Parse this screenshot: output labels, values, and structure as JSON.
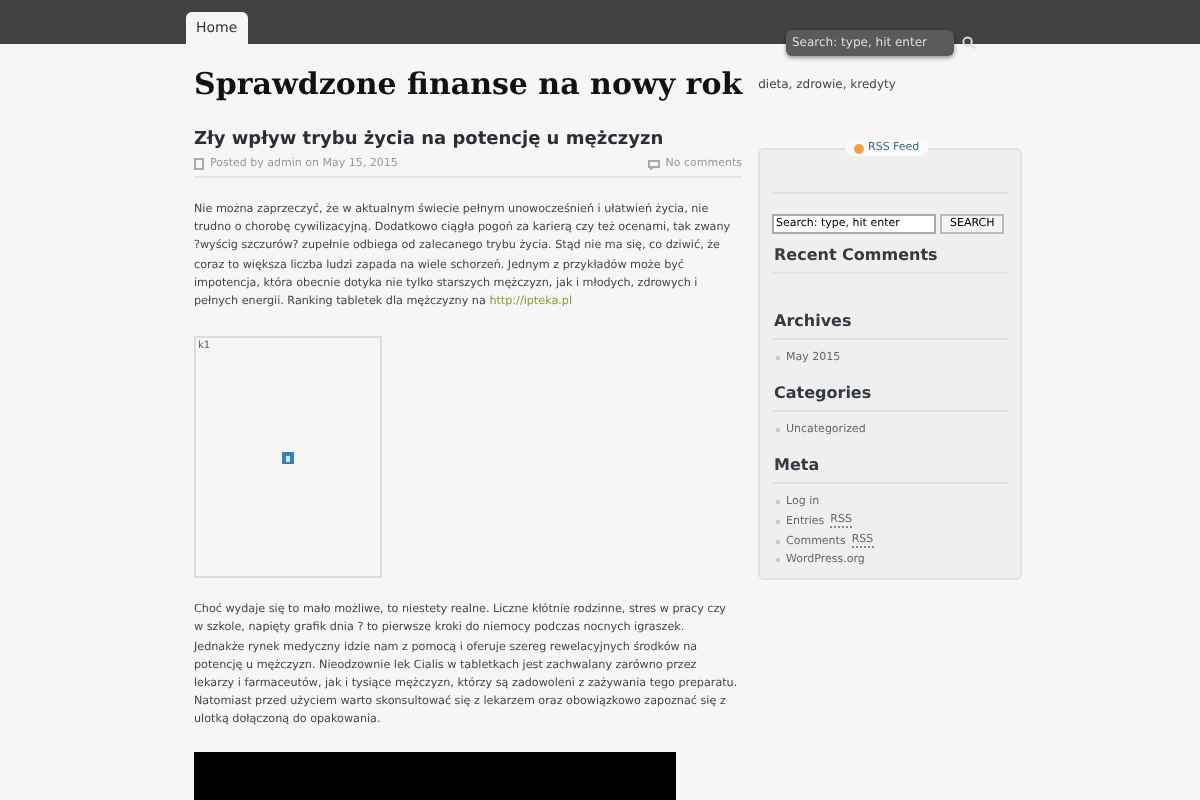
{
  "nav": {
    "tabs": [
      {
        "label": "Home",
        "selected": true
      }
    ],
    "search": {
      "placeholder": "Search: type, hit enter"
    }
  },
  "site": {
    "title": "Sprawdzone finanse na nowy rok",
    "tagline": "dieta, zdrowie, kredyty"
  },
  "post": {
    "title": "Zły wpływ trybu życia na potencję u mężczyzn",
    "meta": "Posted by admin on May 15, 2015",
    "comments": "No comments",
    "paragraph_1": {
      "text": "Nie można zaprzeczyć, że w aktualnym świecie pełnym unowocześnień i ułatwień życia, nie trudno o chorobę cywilizacyjną. Dodatkowo ciągła pogoń za karierą czy też ocenami, tak zwany ?wyścig szczurów? zupełnie odbiega od zalecanego trybu życia. Stąd nie ma się, co dziwić, że coraz to większa liczba ludzi zapada na wiele schorzeń. Jednym z przykładów może być impotencja, która obecnie dotyka nie tylko starszych mężczyzn, jak i młodych, zdrowych i pełnych energii. Ranking tabletek dla mężczyzny na ",
      "link": "http://ipteka.pl"
    },
    "image": {
      "alt": "k1"
    },
    "paragraph_2": "Choć wydaje się to mało możliwe, to niestety realne. Liczne kłótnie rodzinne, stres w pracy czy w szkole, napięty grafik dnia ? to pierwsze kroki do niemocy podczas nocnych igraszek. Jednakże rynek medyczny idzie nam z pomocą i oferuje szereg rewelacyjnych środków na potencję u mężczyzn. Nieodzownie lek Cialis w tabletkach jest zachwalany zarówno przez lekarzy i farmaceutów, jak i tysiące mężczyzn, którzy są zadowoleni z zażywania tego preparatu. Natomiast przed użyciem warto skonsultować się z lekarzem oraz obowiązkowo zapoznać się z ulotką dołączoną do opakowania."
  },
  "sidebar": {
    "rss": "RSS Feed",
    "search": {
      "value": "Search: type, hit enter",
      "button": "SEARCH"
    },
    "widgets": [
      {
        "title": "Recent Comments"
      },
      {
        "title": "Archives",
        "items": [
          {
            "parts": [
              "May 2015"
            ]
          }
        ]
      },
      {
        "title": "Categories",
        "items": [
          {
            "parts": [
              "Uncategorized"
            ]
          }
        ]
      },
      {
        "title": "Meta",
        "items": [
          {
            "parts": [
              "Log in"
            ]
          },
          {
            "parts": [
              "Entries",
              "RSS"
            ]
          },
          {
            "parts": [
              "Comments",
              "RSS"
            ]
          },
          {
            "parts": [
              "WordPress.org"
            ]
          }
        ]
      }
    ]
  }
}
